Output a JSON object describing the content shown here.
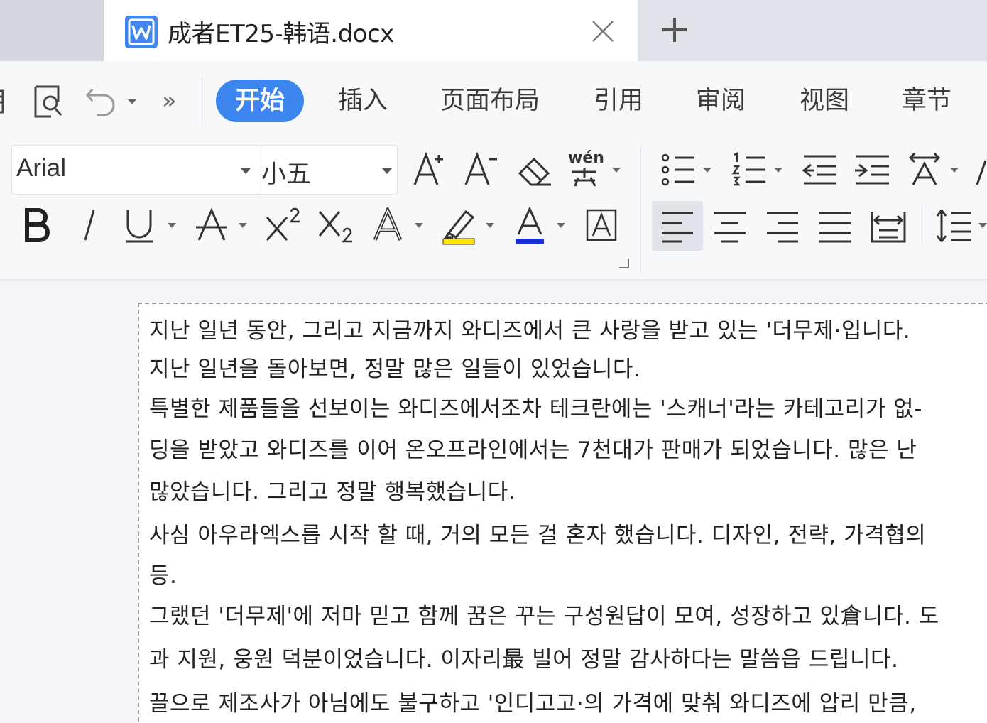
{
  "tabbar": {
    "doc_title": "成者ET25-韩语.docx",
    "doc_icon": "wps-writer-icon",
    "close_icon": "close-icon",
    "add_icon": "plus-icon"
  },
  "toolbar": {
    "menu_tabs": [
      {
        "label": "开始",
        "active": true
      },
      {
        "label": "插入",
        "active": false
      },
      {
        "label": "页面布局",
        "active": false
      },
      {
        "label": "引用",
        "active": false
      },
      {
        "label": "审阅",
        "active": false
      },
      {
        "label": "视图",
        "active": false
      },
      {
        "label": "章节",
        "active": false
      }
    ],
    "more_label": "»",
    "font_name": "Arial",
    "font_size": "小五",
    "pinyin_label": "wén",
    "accent_color": "#3d85ef",
    "highlight_color": "#ffe600",
    "font_color": "#1a2fd6"
  },
  "document": {
    "paragraphs": [
      "지난 일년 동안, 그리고 지금까지 와디즈에서 큰 사랑을 받고 있는 '더무제·입니다.",
      "지난 일년을 돌아보면, 정말 많은 일들이 있었습니다.",
      "특별한 제품들을 선보이는 와디즈에서조차 테크란에는 '스캐너'라는 카테고리가 없-",
      "딩을 받았고 와디즈를 이어 온오프라인에서는 7천대가 판매가 되었습니다. 많은 난",
      "많았습니다. 그리고 정말 행복했습니다.",
      "사심 아우라엑스릅 시작 할 때, 거의 모든 걸 혼자 했습니다. 디자인, 전략, 가격협의",
      "등.",
      "그랬던 '더무제'에 저마 믿고 함께 꿈은 꾸는 구성원답이 모여, 성장하고 있倉니다. 도",
      "과 지원, 웅원 덕분이었습니다. 이자리最 빌어 정말 감사하다는 말씀읍 드립니다.",
      "끌으로 제조사가 아님에도 불구하고 '인디고고·의 가격에 맞춰 와디즈에 압리 만큼,"
    ]
  }
}
